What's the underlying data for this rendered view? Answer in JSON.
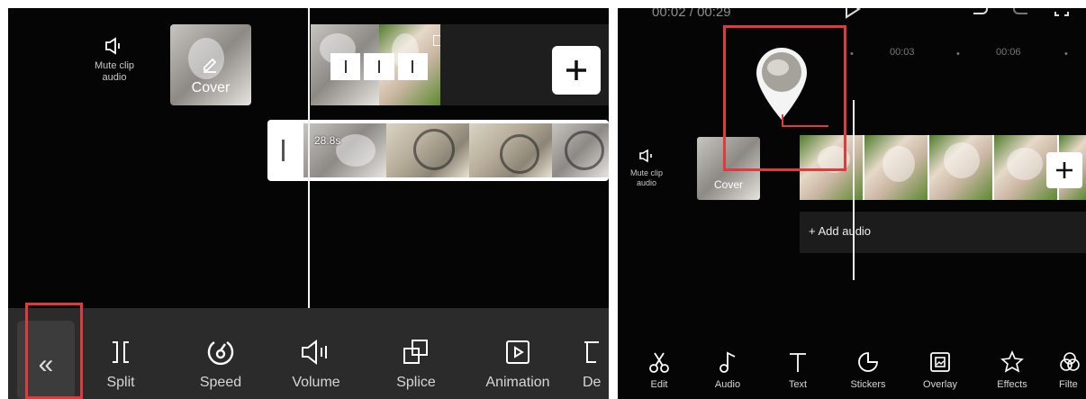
{
  "left": {
    "timeline": {
      "mute_label": "Mute clip\naudio",
      "cover_label": "Cover",
      "clip_time": "28.8s"
    },
    "toolbar": {
      "collapse_label": "«",
      "items": [
        {
          "label": "Split",
          "icon": "split-icon"
        },
        {
          "label": "Speed",
          "icon": "speed-icon"
        },
        {
          "label": "Volume",
          "icon": "volume-icon"
        },
        {
          "label": "Splice",
          "icon": "splice-icon"
        },
        {
          "label": "Animation",
          "icon": "animation-icon"
        },
        {
          "label": "De",
          "icon": "delete-icon"
        }
      ]
    }
  },
  "right": {
    "header": {
      "timecode_current": "00:02",
      "timecode_separator": " / ",
      "timecode_total": "00:29"
    },
    "ruler": {
      "ticks": [
        "00:03",
        "00:06"
      ]
    },
    "timeline": {
      "mute_label": "Mute clip\naudio",
      "cover_label": "Cover",
      "add_audio_label": "+ Add audio"
    },
    "toolbar": {
      "items": [
        {
          "label": "Edit",
          "icon": "scissors-icon"
        },
        {
          "label": "Audio",
          "icon": "music-note-icon"
        },
        {
          "label": "Text",
          "icon": "text-icon"
        },
        {
          "label": "Stickers",
          "icon": "sticker-icon"
        },
        {
          "label": "Overlay",
          "icon": "overlay-icon"
        },
        {
          "label": "Effects",
          "icon": "effects-star-icon"
        },
        {
          "label": "Filte",
          "icon": "filter-icon"
        }
      ]
    }
  },
  "colors": {
    "highlight": "#e0393e",
    "background": "#050505",
    "toolbar_bg": "#2b2b2b"
  }
}
